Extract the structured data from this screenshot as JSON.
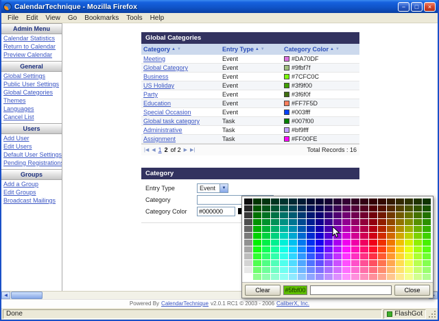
{
  "window": {
    "title": "CalendarTechnique - Mozilla Firefox",
    "menus": [
      "File",
      "Edit",
      "View",
      "Go",
      "Bookmarks",
      "Tools",
      "Help"
    ]
  },
  "icons": {
    "minimize": "−",
    "maximize": "□",
    "close": "×",
    "sort_asc": "▲",
    "sort_desc": "▼",
    "first_page": "|◀",
    "prev_page": "◀",
    "next_page": "▶",
    "last_page": "▶|",
    "dropdown_arrow": "▼",
    "scroll_left": "◀",
    "scroll_right": "▶"
  },
  "colors": {
    "panel_header": "#32325f",
    "table_header_bg": "#ccd9ed",
    "link_blue": "#3a55c4",
    "titlebar_blue": "#1661de"
  },
  "sidebar": {
    "title": "Admin Menu",
    "sections": [
      {
        "header": "",
        "links": [
          "Calendar Statistics",
          "Return to Calendar",
          "Preview Calendar"
        ]
      },
      {
        "header": "General",
        "links": [
          "Global Settings",
          "Public User Settings",
          "Global Categories",
          "Themes",
          "Languages",
          "Cancel List"
        ]
      },
      {
        "header": "Users",
        "links": [
          "Add User",
          "Edit Users",
          "Default User Settings",
          "Pending Registrations"
        ]
      },
      {
        "header": "Groups",
        "links": [
          "Add a Group",
          "Edit Groups",
          "Broadcast Mailings"
        ]
      }
    ]
  },
  "categories_panel": {
    "title": "Global Categories",
    "columns": [
      "Category",
      "Entry Type",
      "Category Color"
    ],
    "rows": [
      {
        "category": "Meeting",
        "entry_type": "Event",
        "color": "#DA70DF"
      },
      {
        "category": "Global Category",
        "entry_type": "Event",
        "color": "#9fbf7f"
      },
      {
        "category": "Business",
        "entry_type": "Event",
        "color": "#7CFC0C"
      },
      {
        "category": "US Holiday",
        "entry_type": "Event",
        "color": "#3f9f00"
      },
      {
        "category": "Party",
        "entry_type": "Event",
        "color": "#3f6f0f"
      },
      {
        "category": "Education",
        "entry_type": "Event",
        "color": "#FF7F5D"
      },
      {
        "category": "Special Occasion",
        "entry_type": "Event",
        "color": "#003fff"
      },
      {
        "category": "Global task category",
        "entry_type": "Task",
        "color": "#007f00"
      },
      {
        "category": "Administrative",
        "entry_type": "Task",
        "color": "#bf9fff"
      },
      {
        "category": "Assignment",
        "entry_type": "Task",
        "color": "#FF00FE"
      }
    ],
    "pagination": {
      "page_links": [
        "1"
      ],
      "current_page": "2",
      "suffix": "of 2"
    },
    "total_label": "Total Records :",
    "total_value": "16"
  },
  "category_form": {
    "title": "Category",
    "entry_type_label": "Entry Type",
    "entry_type_value": "Event",
    "category_label": "Category",
    "category_value": "",
    "color_label": "Category Color",
    "color_value": "#000000"
  },
  "color_picker": {
    "clear_label": "Clear",
    "preview_hex": "#5fbf00",
    "preview_color": "#5fbf00",
    "input_value": "",
    "close_label": "Close",
    "palette": {
      "columns": 21,
      "rows": 12,
      "hue_start": 120,
      "light_min": 10,
      "light_max": 78
    }
  },
  "footer": {
    "prefix": "Powered By",
    "brand_link": "CalendarTechnique",
    "version_text": "v2.0.1 RC1 © 2003 - 2006",
    "company_link": "CaliberX, Inc."
  },
  "status_bar": {
    "left": "Done",
    "right": "FlashGot"
  }
}
